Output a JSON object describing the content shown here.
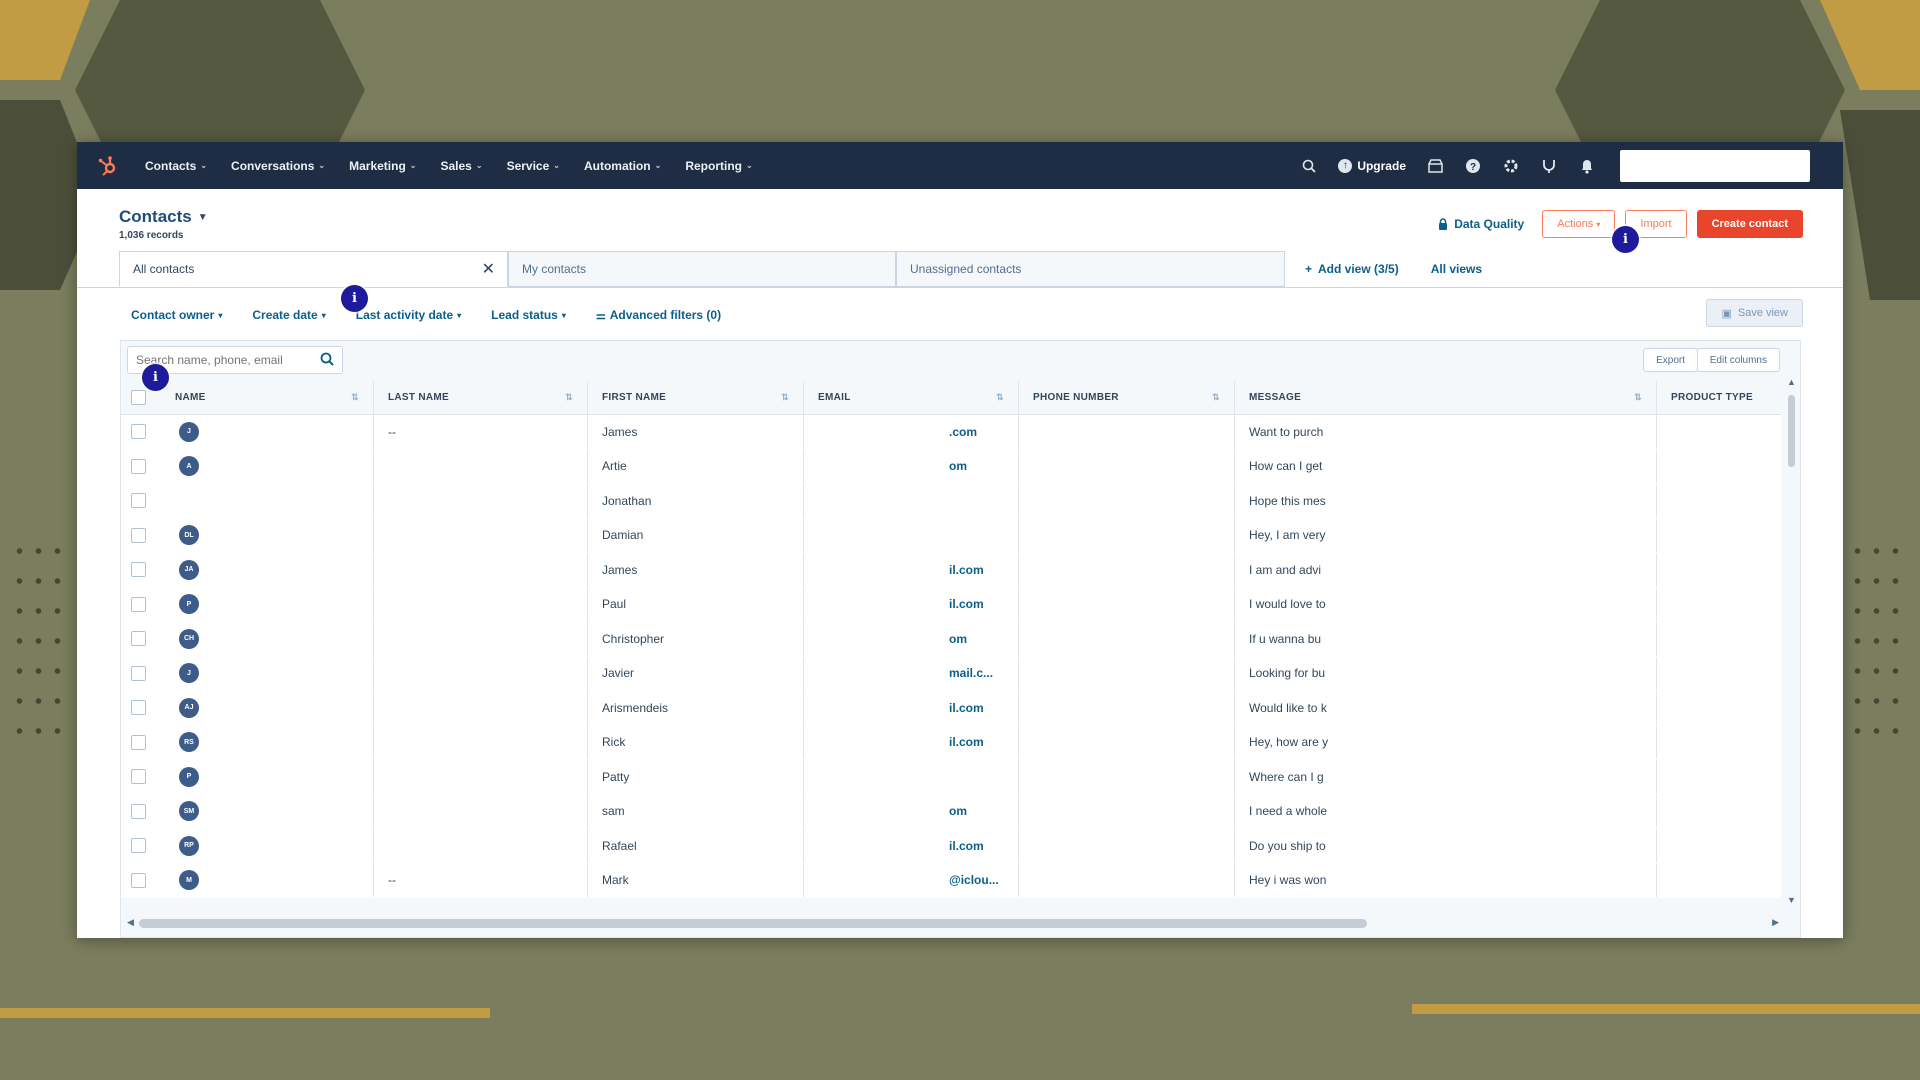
{
  "nav": {
    "items": [
      {
        "label": "Contacts"
      },
      {
        "label": "Conversations"
      },
      {
        "label": "Marketing"
      },
      {
        "label": "Sales"
      },
      {
        "label": "Service"
      },
      {
        "label": "Automation"
      },
      {
        "label": "Reporting"
      }
    ],
    "upgrade_label": "Upgrade",
    "icons": [
      "search-icon",
      "upgrade-icon",
      "marketplace-icon",
      "help-icon",
      "settings-icon",
      "notifications-icon",
      "bell-icon"
    ]
  },
  "header": {
    "title": "Contacts",
    "records": "1,036 records",
    "data_quality": "Data Quality",
    "actions_label": "Actions",
    "import_label": "Import",
    "create_label": "Create contact"
  },
  "views": {
    "tabs": [
      {
        "label": "All contacts"
      },
      {
        "label": "My contacts"
      },
      {
        "label": "Unassigned contacts"
      }
    ],
    "add_view": "Add view (3/5)",
    "all_views": "All views"
  },
  "filters": {
    "items": [
      {
        "label": "Contact owner"
      },
      {
        "label": "Create date"
      },
      {
        "label": "Last activity date"
      },
      {
        "label": "Lead status"
      },
      {
        "label": "Advanced filters (0)"
      }
    ],
    "save_view": "Save view"
  },
  "table": {
    "search_placeholder": "Search name, phone, email",
    "export_label": "Export",
    "edit_columns_label": "Edit columns",
    "columns": [
      "NAME",
      "LAST NAME",
      "FIRST NAME",
      "EMAIL",
      "PHONE NUMBER",
      "MESSAGE",
      "PRODUCT TYPE"
    ],
    "rows": [
      {
        "initials": "J",
        "last": "--",
        "first": "James",
        "email": ".com",
        "message": "Want to purch"
      },
      {
        "initials": "A",
        "last": "",
        "first": "Artie",
        "email": "om",
        "message": "How can I get"
      },
      {
        "initials": "",
        "last": "",
        "first": "Jonathan",
        "email": "",
        "message": "Hope this mes"
      },
      {
        "initials": "DL",
        "last": "",
        "first": "Damian",
        "email": "",
        "message": "Hey, I am very"
      },
      {
        "initials": "JA",
        "last": "",
        "first": "James",
        "email": "il.com",
        "message": "I am and advi"
      },
      {
        "initials": "P",
        "last": "",
        "first": "Paul",
        "email": "il.com",
        "message": "I would love to"
      },
      {
        "initials": "CH",
        "last": "",
        "first": "Christopher",
        "email": "om",
        "message": "If u wanna bu"
      },
      {
        "initials": "J",
        "last": "",
        "first": "Javier",
        "email": "mail.c...",
        "message": "Looking for bu"
      },
      {
        "initials": "AJ",
        "last": "",
        "first": "Arismendeis",
        "email": "il.com",
        "message": "Would like to k"
      },
      {
        "initials": "RS",
        "last": "",
        "first": "Rick",
        "email": "il.com",
        "message": "Hey, how are y"
      },
      {
        "initials": "P",
        "last": "",
        "first": "Patty",
        "email": "",
        "message": "Where can I g"
      },
      {
        "initials": "SM",
        "last": "",
        "first": "sam",
        "email": "om",
        "message": "I need a whole"
      },
      {
        "initials": "RP",
        "last": "",
        "first": "Rafael",
        "email": "il.com",
        "message": "Do you ship to"
      },
      {
        "initials": "M",
        "last": "--",
        "first": "Mark",
        "email": "@iclou...",
        "message": "Hey i was won"
      }
    ]
  },
  "badges": {
    "info_glyph": "i"
  },
  "colors": {
    "nav_bg": "#1f2d44",
    "accent_orange": "#e8452c",
    "link_blue": "#0b5f8a",
    "background": "#7a7d5e",
    "stripe_gold": "#c29c44",
    "badge_blue": "#1d1b9c"
  }
}
